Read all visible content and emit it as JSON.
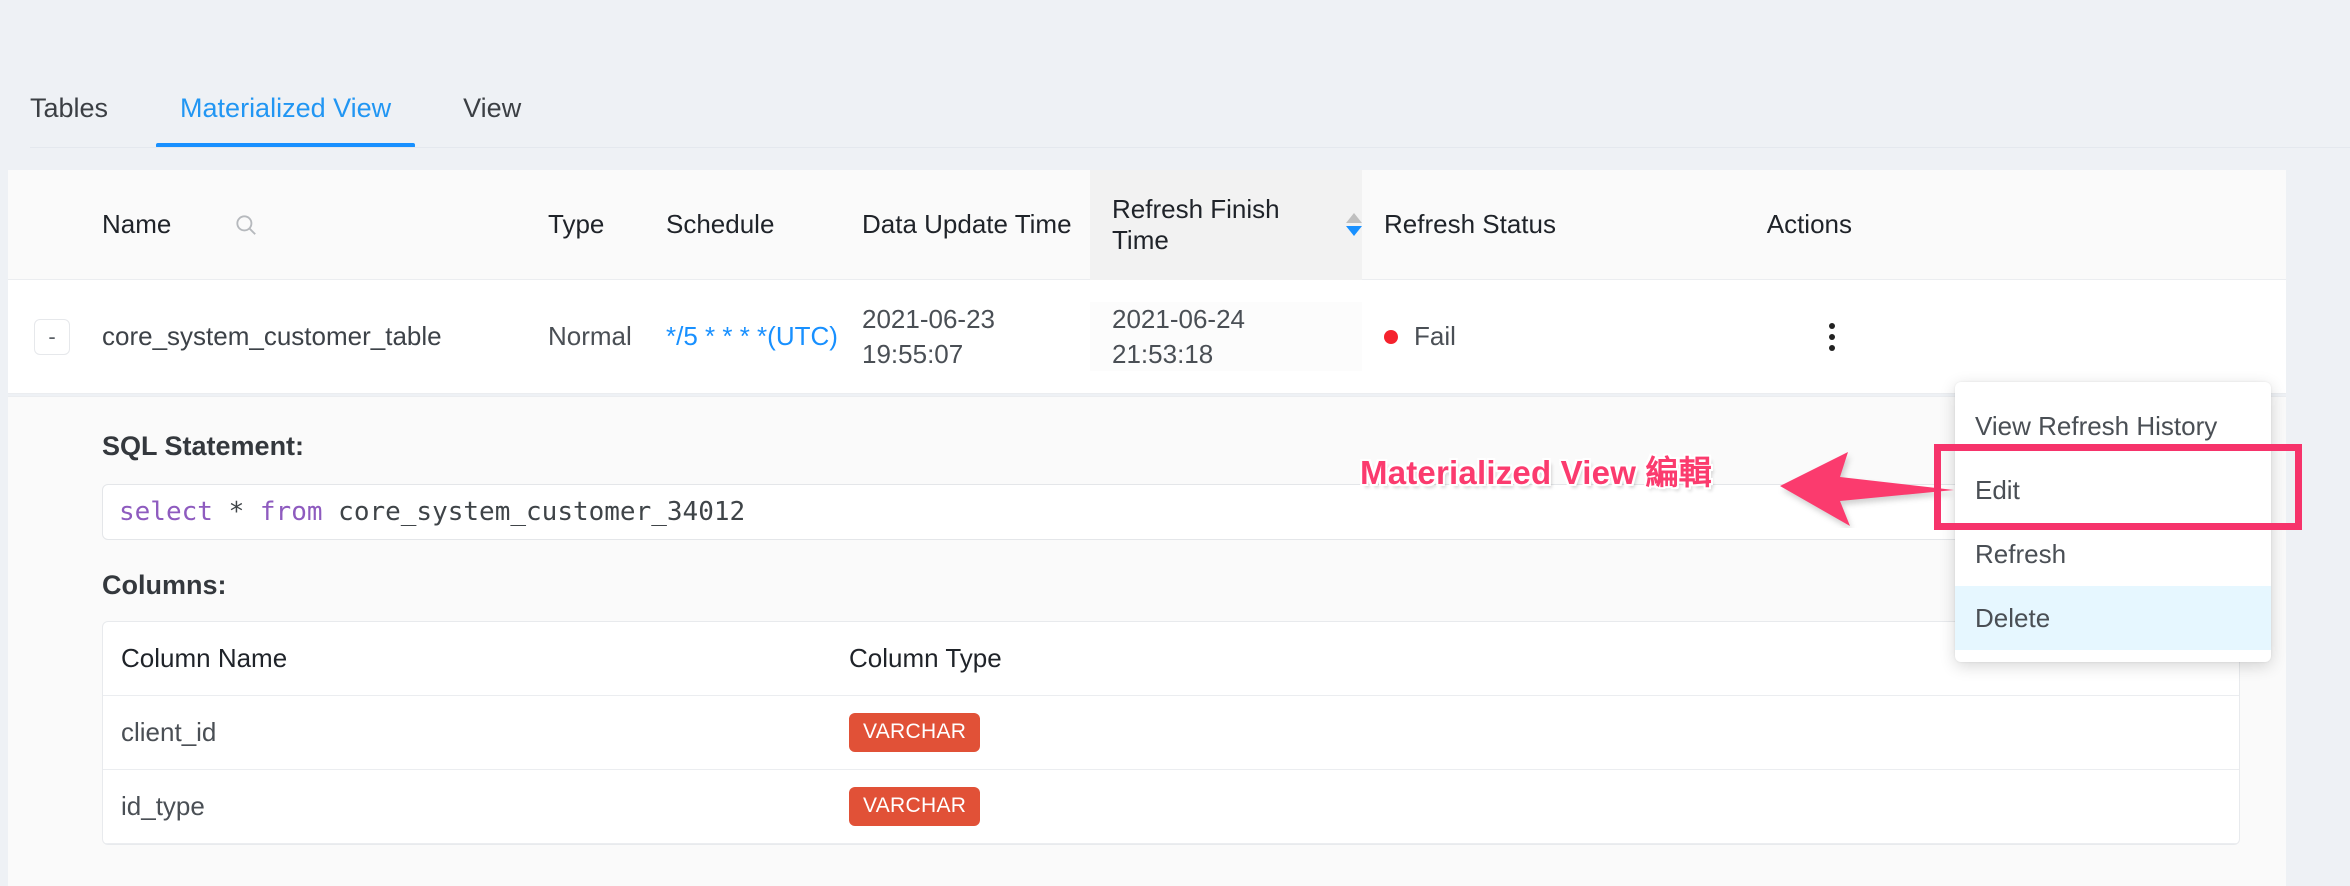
{
  "tabs": [
    {
      "label": "Tables",
      "active": false
    },
    {
      "label": "Materialized View",
      "active": true
    },
    {
      "label": "View",
      "active": false
    }
  ],
  "table": {
    "headers": {
      "name": "Name",
      "type": "Type",
      "schedule": "Schedule",
      "data_update_time": "Data Update Time",
      "refresh_finish_time": "Refresh Finish Time",
      "refresh_status": "Refresh Status",
      "actions": "Actions"
    },
    "sort": {
      "column": "Refresh Finish Time",
      "direction": "desc"
    },
    "rows": [
      {
        "expand_symbol": "-",
        "name": "core_system_customer_table",
        "type": "Normal",
        "schedule": "*/5 * * * *(UTC)",
        "data_update_date": "2021-06-23",
        "data_update_clock": "19:55:07",
        "refresh_finish_date": "2021-06-24",
        "refresh_finish_clock": "21:53:18",
        "status": "Fail",
        "status_color": "#f5222d"
      }
    ]
  },
  "detail": {
    "sql_label": "SQL Statement:",
    "sql": {
      "kw1": "select",
      "star": " * ",
      "kw2": "from",
      "rest": " core_system_customer_34012"
    },
    "columns_label": "Columns:",
    "columns_table": {
      "headers": {
        "name": "Column Name",
        "type": "Column Type"
      },
      "rows": [
        {
          "name": "client_id",
          "type": "VARCHAR"
        },
        {
          "name": "id_type",
          "type": "VARCHAR"
        }
      ]
    },
    "badge_color": "#e15137"
  },
  "action_menu": {
    "items": [
      {
        "label": "View Refresh History",
        "hover": false
      },
      {
        "label": "Edit",
        "hover": false
      },
      {
        "label": "Refresh",
        "hover": false
      },
      {
        "label": "Delete",
        "hover": true
      }
    ]
  },
  "annotation": {
    "text": "Materialized View 編輯",
    "color": "#fb3b6e",
    "highlight_target": "Edit"
  }
}
